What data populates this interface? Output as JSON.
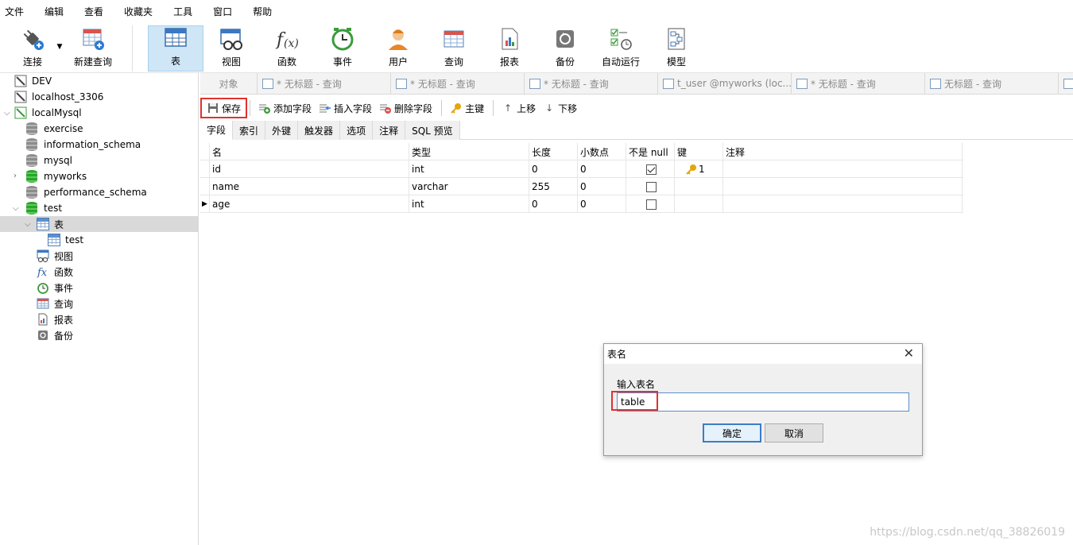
{
  "menu": [
    "文件",
    "编辑",
    "查看",
    "收藏夹",
    "工具",
    "窗口",
    "帮助"
  ],
  "toolbar": {
    "connect": "连接",
    "new_query": "新建查询",
    "table": "表",
    "view": "视图",
    "function": "函数",
    "event": "事件",
    "user": "用户",
    "query": "查询",
    "report": "报表",
    "backup": "备份",
    "autorun": "自动运行",
    "model": "模型"
  },
  "sidebar": {
    "dev": "DEV",
    "localhost": "localhost_3306",
    "localmysql": "localMysql",
    "db_exercise": "exercise",
    "db_information_schema": "information_schema",
    "db_mysql": "mysql",
    "db_myworks": "myworks",
    "db_performance_schema": "performance_schema",
    "db_test": "test",
    "tables": "表",
    "table_test": "test",
    "views": "视图",
    "functions": "函数",
    "events": "事件",
    "queries": "查询",
    "reports": "报表",
    "backups": "备份"
  },
  "tabs": {
    "objects": "对象",
    "t1": "* 无标题 - 查询",
    "t2": "* 无标题 - 查询",
    "t3": "* 无标题 - 查询",
    "t4": "t_user @myworks (loc...",
    "t5": "* 无标题 - 查询",
    "t6": "无标题 - 查询"
  },
  "subtoolbar": {
    "save": "保存",
    "add_field": "添加字段",
    "insert_field": "插入字段",
    "delete_field": "删除字段",
    "primary_key": "主键",
    "move_up": "上移",
    "move_down": "下移"
  },
  "innertabs": [
    "字段",
    "索引",
    "外键",
    "触发器",
    "选项",
    "注释",
    "SQL 预览"
  ],
  "grid": {
    "headers": [
      "名",
      "类型",
      "长度",
      "小数点",
      "不是 null",
      "键",
      "注释"
    ],
    "rows": [
      {
        "name": "id",
        "type": "int",
        "length": "0",
        "decimals": "0",
        "notnull": true,
        "key": "1"
      },
      {
        "name": "name",
        "type": "varchar",
        "length": "255",
        "decimals": "0",
        "notnull": false,
        "key": ""
      },
      {
        "name": "age",
        "type": "int",
        "length": "0",
        "decimals": "0",
        "notnull": false,
        "key": ""
      }
    ]
  },
  "dialog": {
    "title": "表名",
    "label": "输入表名",
    "value": "table",
    "ok": "确定",
    "cancel": "取消"
  },
  "watermark": "https://blog.csdn.net/qq_38826019"
}
